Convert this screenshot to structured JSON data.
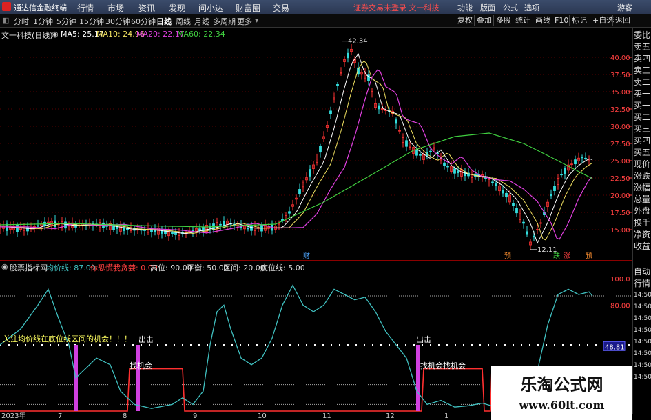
{
  "app": {
    "title": "通达信金融终端"
  },
  "menu": [
    "行情",
    "市场",
    "资讯",
    "发现",
    "问小达",
    "财富圈",
    "交易"
  ],
  "notice": "证券交易未登录  文一科技",
  "right_menu": [
    "功能",
    "版面",
    "公式",
    "选项"
  ],
  "guest": "游客",
  "periods": [
    "分时",
    "1分钟",
    "5分钟",
    "15分钟",
    "30分钟",
    "60分钟",
    "日线",
    "周线",
    "月线",
    "多周期",
    "更多"
  ],
  "active_period": "日线",
  "tools": [
    "复权",
    "叠加",
    "多股",
    "统计",
    "画线",
    "F10",
    "标记",
    "+自选",
    "返回"
  ],
  "main": {
    "stock": "文一科技(日线)",
    "ma": [
      {
        "label": "MA5: 25.17",
        "color": "#ffffff"
      },
      {
        "label": "MA10: 24.96",
        "color": "#f0e060"
      },
      {
        "label": "MA20: 22.17",
        "color": "#e040e0"
      },
      {
        "label": "MA60: 22.34",
        "color": "#40d040"
      }
    ],
    "price_ticks": [
      "40.00",
      "37.50",
      "35.00",
      "32.50",
      "30.00",
      "27.50",
      "25.00",
      "22.50",
      "20.00",
      "17.50",
      "15.00"
    ],
    "high_label": "42.34",
    "low_label": "12.11",
    "markers": [
      {
        "text": "财",
        "color": "#4da6ff"
      },
      {
        "text": "预",
        "color": "#ff9030"
      },
      {
        "text": "跌",
        "color": "#40d040"
      },
      {
        "text": "涨",
        "color": "#ff4040"
      },
      {
        "text": "预",
        "color": "#ff9030"
      }
    ]
  },
  "indicator": {
    "name": "股票指标网",
    "params": [
      {
        "label": "均价线: 87.00",
        "color": "#40c0c0"
      },
      {
        "label": "你恐慌我贪婪: 0.00",
        "color": "#ff4040"
      },
      {
        "label": "高位: 90.00",
        "color": "#dddddd"
      },
      {
        "label": "平衡: 50.00",
        "color": "#dddddd"
      },
      {
        "label": "区间: 20.00",
        "color": "#dddddd"
      },
      {
        "label": "底位线: 5.00",
        "color": "#dddddd"
      }
    ],
    "y_ticks": [
      "100.0",
      "80.00"
    ],
    "current_value": "48.81",
    "notice": "关注均价线在底位线区间的机会！！！",
    "signal_out": "出击",
    "signal_find": "找机会",
    "signal_find2": "找机会",
    "signal_find3": "找机会"
  },
  "right_panel": {
    "items": [
      "委比",
      "卖五",
      "卖四",
      "卖三",
      "卖二",
      "卖一",
      "买一",
      "买二",
      "买三",
      "买四",
      "买五",
      "现价",
      "涨跌",
      "涨幅",
      "总量",
      "外盘",
      "换手",
      "净资",
      "收益"
    ],
    "items2": [
      "自动",
      "行情",
      "14:50",
      "14:50",
      "14:50",
      "14:50",
      "14:50",
      "14:50",
      "14:50",
      "14:50"
    ]
  },
  "x_axis": [
    "2023年",
    "7",
    "8",
    "9",
    "10",
    "11",
    "12",
    "1"
  ],
  "watermark": {
    "title": "乐淘公式网",
    "url": "www.60lt.com"
  }
}
